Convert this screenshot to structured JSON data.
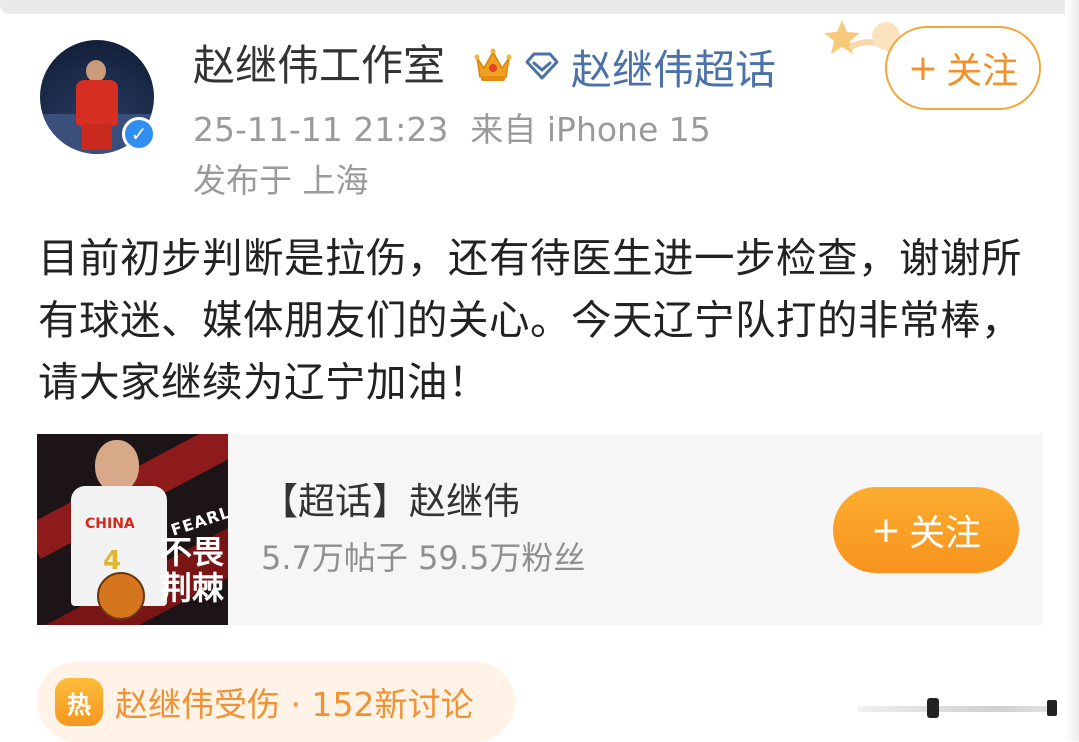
{
  "post": {
    "author": "赵继伟工作室",
    "supertopic_link": "赵继伟超话",
    "follow_label": "关注",
    "timestamp": "25-11-11 21:23",
    "source": "来自 iPhone 15",
    "location": "发布于 上海",
    "body": "目前初步判断是拉伤，还有待医生进一步检查，谢谢所有球迷、媒体朋友们的关心。今天辽宁队打的非常棒，请大家继续为辽宁加油！"
  },
  "card": {
    "title": "【超话】赵继伟",
    "stats": "5.7万帖子 59.5万粉丝",
    "follow_label": "关注",
    "image": {
      "jersey_text": "CHINA",
      "jersey_number": "4",
      "tagline": "FEARLESS",
      "slogan": "不畏荆棘"
    }
  },
  "hot_topic": {
    "icon_label": "热",
    "text": "赵继伟受伤 · 152新讨论"
  },
  "icons": {
    "plus": "+",
    "verified": "✓"
  },
  "colors": {
    "accent_orange": "#f7931e",
    "link_blue": "#4a72a8",
    "verified_blue": "#2e8ff0",
    "hot_bg": "#fff2e6"
  }
}
